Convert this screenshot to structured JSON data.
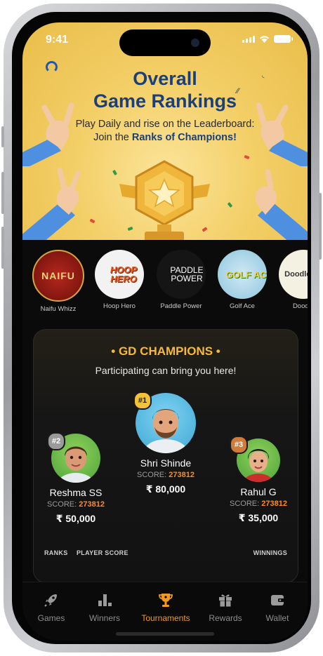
{
  "status_bar": {
    "time": "9:41"
  },
  "banner": {
    "title_line1": "Overall",
    "title_line2": "Game Rankings",
    "subtitle_line1": "Play Daily and rise on the Leaderboard:",
    "subtitle_line2_prefix": "Join the ",
    "subtitle_line2_bold": "Ranks of Champions!"
  },
  "games": [
    {
      "label": "Naifu Whizz",
      "logo_text": "NAIFU",
      "icon": "naifu-whizz-game-icon"
    },
    {
      "label": "Hoop Hero",
      "logo_text": "HOOP HERO",
      "icon": "hoop-hero-game-icon"
    },
    {
      "label": "Paddle Power",
      "logo_text": "PADDLE POWER",
      "icon": "paddle-power-game-icon"
    },
    {
      "label": "Golf Ace",
      "logo_text": "GOLF ACE",
      "icon": "golf-ace-game-icon"
    },
    {
      "label": "Doodle",
      "logo_text": "Doodle Jump",
      "icon": "doodle-jump-game-icon"
    }
  ],
  "champions": {
    "title": "• GD CHAMPIONS •",
    "subtitle": "Participating can bring you here!",
    "score_label": "SCORE:",
    "players": [
      {
        "rank": "#1",
        "name": "Shri Shinde",
        "score": "273812",
        "prize": "₹ 80,000"
      },
      {
        "rank": "#2",
        "name": "Reshma SS",
        "score": "273812",
        "prize": "₹ 50,000"
      },
      {
        "rank": "#3",
        "name": "Rahul G",
        "score": "273812",
        "prize": "₹ 35,000"
      }
    ],
    "columns": {
      "ranks": "RANKS",
      "player_score": "PLAYER SCORE",
      "winnings": "WINNINGS"
    }
  },
  "nav": [
    {
      "label": "Games",
      "icon": "rocket-icon",
      "active": false
    },
    {
      "label": "Winners",
      "icon": "bar-chart-icon",
      "active": false
    },
    {
      "label": "Tournaments",
      "icon": "trophy-icon",
      "active": true
    },
    {
      "label": "Rewards",
      "icon": "gift-icon",
      "active": false
    },
    {
      "label": "Wallet",
      "icon": "wallet-icon",
      "active": false
    }
  ],
  "colors": {
    "accent": "#f39a1e",
    "score_highlight": "#ff8a1f",
    "title_blue": "#1b3f7a",
    "banner_gold": "#f3cf67"
  }
}
